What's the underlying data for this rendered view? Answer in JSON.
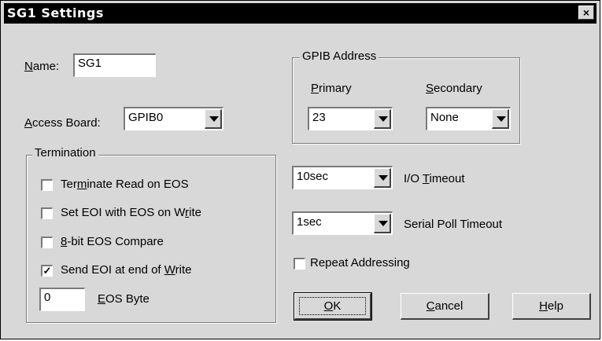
{
  "window": {
    "title": "SG1 Settings",
    "close_glyph": "×"
  },
  "name": {
    "label_prefix": "N",
    "label_rest": "ame:",
    "value": "SG1"
  },
  "access_board": {
    "label_prefix": "A",
    "label_rest": "ccess Board:",
    "value": "GPIB0"
  },
  "termination": {
    "title": "Termination",
    "options": [
      {
        "pre": "Ter",
        "u": "m",
        "post": "inate Read on EOS",
        "checked": false
      },
      {
        "pre": "Set EOI with EOS on W",
        "u": "r",
        "post": "ite",
        "checked": false
      },
      {
        "pre": "",
        "u": "8",
        "post": "-bit EOS Compare",
        "checked": false
      },
      {
        "pre": "Send EOI at end of ",
        "u": "W",
        "post": "rite",
        "checked": true
      }
    ],
    "eos_byte": {
      "value": "0",
      "label_u": "E",
      "label_rest": "OS Byte"
    }
  },
  "gpib_address": {
    "title": "GPIB Address",
    "primary": {
      "label_u": "P",
      "label_rest": "rimary",
      "value": "23"
    },
    "secondary": {
      "label_u": "S",
      "label_rest": "econdary",
      "value": "None"
    }
  },
  "io_timeout": {
    "value": "10sec",
    "label_pre": "I/O ",
    "label_u": "T",
    "label_rest": "imeout"
  },
  "serial_poll_timeout": {
    "value": "1sec",
    "label": "Serial Poll Timeout"
  },
  "repeat_addressing": {
    "label": "Repeat Addressing",
    "checked": false
  },
  "buttons": {
    "ok": {
      "u": "O",
      "rest": "K"
    },
    "cancel": {
      "u": "C",
      "rest": "ancel"
    },
    "help": {
      "u": "H",
      "rest": "elp"
    }
  },
  "colors": {
    "face": "#d8d8d8",
    "titlebar": "#000000",
    "title_text": "#ffffff"
  },
  "check_glyph": "✓"
}
